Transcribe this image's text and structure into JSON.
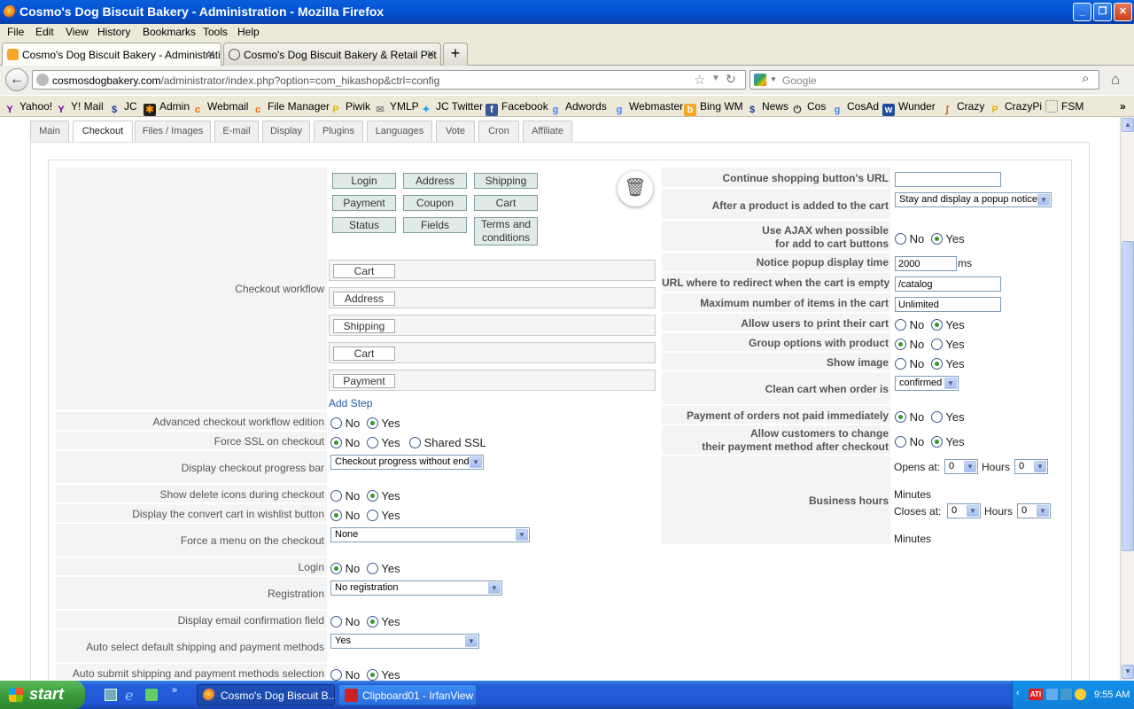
{
  "window": {
    "title": "Cosmo's Dog Biscuit Bakery - Administration - Mozilla Firefox"
  },
  "menubar": [
    "File",
    "Edit",
    "View",
    "History",
    "Bookmarks",
    "Tools",
    "Help"
  ],
  "browser_tabs": [
    {
      "label": "Cosmo's Dog Biscuit Bakery - Administrati...",
      "active": true
    },
    {
      "label": "Cosmo's Dog Biscuit Bakery & Retail Pet S...",
      "active": false
    }
  ],
  "address": {
    "domain": "cosmosdogbakery.com",
    "path": "/administrator/index.php?option=com_hikashop&ctrl=config"
  },
  "search": {
    "placeholder": "Google"
  },
  "bookmarks": [
    "Yahoo!",
    "Y! Mail",
    "JC",
    "Admin",
    "Webmail",
    "File Manager",
    "Piwik",
    "YMLP",
    "JC Twitter",
    "Facebook",
    "Adwords",
    "Webmaster",
    "Bing WM",
    "News",
    "Cos",
    "CosAd",
    "Wunder",
    "Crazy",
    "CrazyPi",
    "FSM"
  ],
  "admin_tabs": [
    "Main",
    "Checkout",
    "Files / Images",
    "E-mail",
    "Display",
    "Plugins",
    "Languages",
    "Vote",
    "Cron",
    "Affiliate"
  ],
  "workflow": {
    "label": "Checkout workflow",
    "palette": [
      "Login",
      "Address",
      "Shipping",
      "Payment",
      "Coupon",
      "Cart",
      "Status",
      "Fields",
      "Terms and conditions"
    ],
    "steps": [
      "Cart",
      "Address",
      "Shipping",
      "Cart",
      "Payment"
    ],
    "add_step": "Add Step"
  },
  "left_options": {
    "advanced": {
      "label": "Advanced checkout workflow edition",
      "no": "No",
      "yes": "Yes"
    },
    "ssl": {
      "label": "Force SSL on checkout",
      "no": "No",
      "yes": "Yes",
      "shared": "Shared SSL"
    },
    "progress": {
      "label": "Display checkout progress bar",
      "value": "Checkout progress without end"
    },
    "delete_icons": {
      "label": "Show delete icons during checkout",
      "no": "No",
      "yes": "Yes"
    },
    "convert": {
      "label": "Display the convert cart in wishlist button",
      "no": "No",
      "yes": "Yes"
    },
    "force_menu": {
      "label": "Force a menu on the checkout",
      "value": "None"
    },
    "login": {
      "label": "Login",
      "no": "No",
      "yes": "Yes"
    },
    "registration": {
      "label": "Registration",
      "value": "No registration"
    },
    "email_confirm": {
      "label": "Display email confirmation field",
      "no": "No",
      "yes": "Yes"
    },
    "auto_select": {
      "label": "Auto select default shipping and payment methods",
      "value": "Yes"
    },
    "auto_submit": {
      "label": "Auto submit shipping and payment methods selection",
      "no": "No",
      "yes": "Yes"
    }
  },
  "right_options": {
    "continue_url": {
      "label": "Continue shopping button's URL",
      "value": ""
    },
    "after_added": {
      "label": "After a product is added to the cart",
      "value": "Stay and display a popup notice"
    },
    "ajax": {
      "label1": "Use AJAX when possible",
      "label2": "for add to cart buttons",
      "no": "No",
      "yes": "Yes"
    },
    "popup_time": {
      "label": "Notice popup display time",
      "value": "2000",
      "unit": "ms"
    },
    "redirect_empty": {
      "label": "URL where to redirect when the cart is empty",
      "value": "/catalog"
    },
    "max_items": {
      "label": "Maximum number of items in the cart",
      "value": "Unlimited"
    },
    "print_cart": {
      "label": "Allow users to print their cart",
      "no": "No",
      "yes": "Yes"
    },
    "group_options": {
      "label": "Group options with product",
      "no": "No",
      "yes": "Yes"
    },
    "show_image": {
      "label": "Show image",
      "no": "No",
      "yes": "Yes"
    },
    "clean_cart": {
      "label": "Clean cart when order is",
      "value": "confirmed"
    },
    "payment_not_paid": {
      "label": "Payment of orders not paid immediately",
      "no": "No",
      "yes": "Yes"
    },
    "change_payment": {
      "label1": "Allow customers to change",
      "label2": "their payment method after checkout",
      "no": "No",
      "yes": "Yes"
    },
    "business_hours": {
      "label": "Business hours",
      "opens": "Opens at:",
      "closes": "Closes at:",
      "hours": "Hours",
      "minutes": "Minutes",
      "open_h": "0",
      "open_m": "0",
      "close_h": "0",
      "close_m": "0"
    }
  },
  "taskbar": {
    "start": "start",
    "tasks": [
      "Cosmo's Dog Biscuit B...",
      "Clipboard01 - IrfanView"
    ],
    "time": "9:55 AM"
  }
}
